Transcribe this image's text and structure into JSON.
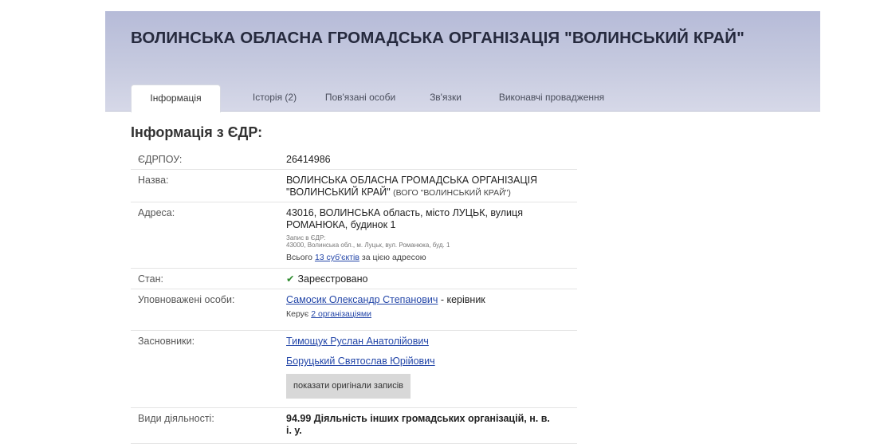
{
  "header": {
    "title": "ВОЛИНСЬКА ОБЛАСНА ГРОМАДСЬКА ОРГАНІЗАЦІЯ \"ВОЛИНСЬКИЙ КРАЙ\""
  },
  "tabs": [
    {
      "label": "Інформація",
      "active": true
    },
    {
      "label": "Історія (2)"
    },
    {
      "label": "Пов'язані особи"
    },
    {
      "label": "Зв'язки"
    },
    {
      "label": "Виконавчі провадження"
    }
  ],
  "section_title": "Інформація з ЄДР:",
  "rows": {
    "edrpou": {
      "label": "ЄДРПОУ:",
      "value": "26414986"
    },
    "name": {
      "label": "Назва:",
      "value_line1": "ВОЛИНСЬКА ОБЛАСНА ГРОМАДСЬКА ОРГАНІЗАЦІЯ",
      "value_line2": "\"ВОЛИНСЬКИЙ КРАЙ\"",
      "short_name": "(ВОГО \"ВОЛИНСЬКИЙ КРАЙ\")"
    },
    "address": {
      "label": "Адреса:",
      "value_line1": "43016, ВОЛИНСЬКА область, місто ЛУЦЬК, вулиця",
      "value_line2": "РОМАНЮКА, будинок 1",
      "edr_record_label": "Запис в ЄДР:",
      "edr_record": "43000, Волинська обл., м. Луцьк, вул. Романюка, буд. 1",
      "total_prefix": "Всього",
      "total_link": "13 суб'єктів",
      "total_suffix": "за цією адресою"
    },
    "status": {
      "label": "Стан:",
      "value": "Зареєстровано",
      "icon": "check-icon"
    },
    "authorized": {
      "label": "Уповноважені особи:",
      "person": "Самосик Олександр Степанович",
      "role": "- керівник",
      "manages_prefix": "Керує",
      "manages_link": "2 організаціями"
    },
    "founders": {
      "label": "Засновники:",
      "items": [
        "Тимощук Руслан Анатолійович",
        "Боруцький Святослав Юрійович"
      ],
      "button": "показати оригінали записів"
    },
    "activities": {
      "label": "Види діяльності:",
      "value_line1": "94.99 Діяльність інших громадських організацій, н. в.",
      "value_line2": "і. у."
    }
  },
  "colors": {
    "link": "#2346a8",
    "header_bg": "#c0c4dc",
    "ok_green": "#2e8b2e"
  }
}
